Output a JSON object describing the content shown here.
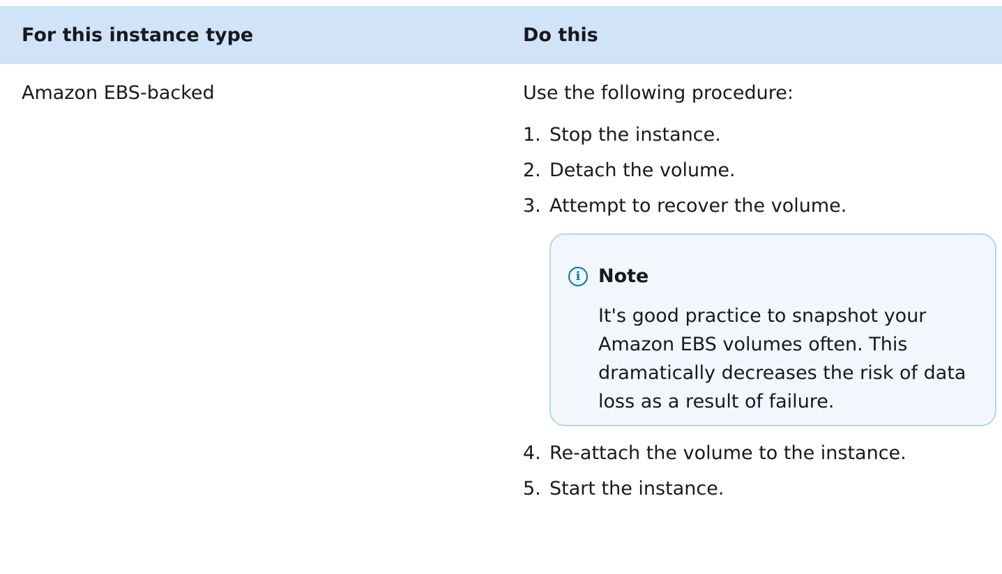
{
  "table": {
    "headers": {
      "type": "For this instance type",
      "action": "Do this"
    },
    "row": {
      "type": "Amazon EBS-backed",
      "intro": "Use the following procedure:",
      "steps": [
        {
          "num": "1.",
          "text": "Stop the instance."
        },
        {
          "num": "2.",
          "text": "Detach the volume."
        },
        {
          "num": "3.",
          "text": "Attempt to recover the volume."
        },
        {
          "num": "4.",
          "text": "Re-attach the volume to the instance."
        },
        {
          "num": "5.",
          "text": "Start the instance."
        }
      ],
      "note": {
        "icon": "info-icon",
        "title": "Note",
        "body": "It's good practice to snapshot your Amazon EBS volumes often. This dramatically decreases the risk of data loss as a result of failure."
      }
    }
  },
  "colors": {
    "header_bg": "#d1e4f7",
    "note_bg": "#f1f7fd",
    "note_border": "#b7d3ec",
    "info_blue": "#0073bb",
    "text": "#16191f"
  }
}
